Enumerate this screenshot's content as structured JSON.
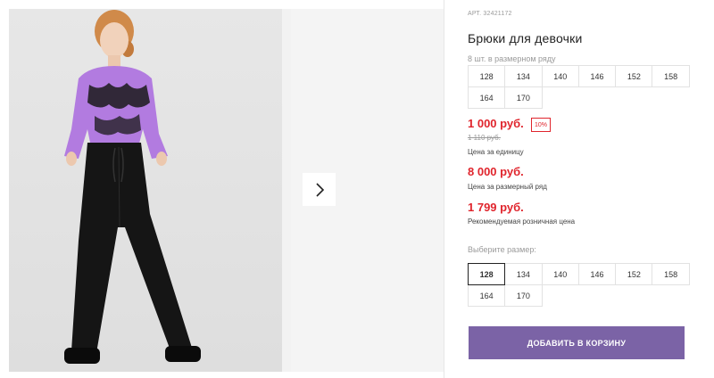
{
  "product": {
    "sku": "АРТ. 32421172",
    "title": "Брюки для девочки"
  },
  "size_row": {
    "label": "8 шт. в размерном ряду",
    "sizes": [
      "128",
      "134",
      "140",
      "146",
      "152",
      "158",
      "164",
      "170"
    ]
  },
  "prices": {
    "unit_price": "1 000 руб.",
    "discount_badge": "10%",
    "old_price": "1 110 руб.",
    "unit_caption": "Цена за единицу",
    "row_price": "8 000 руб.",
    "row_caption": "Цена за размерный ряд",
    "rrp": "1 799 руб.",
    "rrp_caption": "Рекомендуемая розничная цена"
  },
  "size_select": {
    "label": "Выберите размер:",
    "selected": "128",
    "sizes": [
      "128",
      "134",
      "140",
      "146",
      "152",
      "158",
      "164",
      "170"
    ]
  },
  "cart_button": "ДОБАВИТЬ В КОРЗИНУ",
  "colors": {
    "price_red": "#e0252d",
    "cart_purple": "#7b63a6",
    "top_purple": "#b27be0",
    "pants_black": "#151515"
  },
  "icons": {
    "next": "chevron-right-icon"
  }
}
